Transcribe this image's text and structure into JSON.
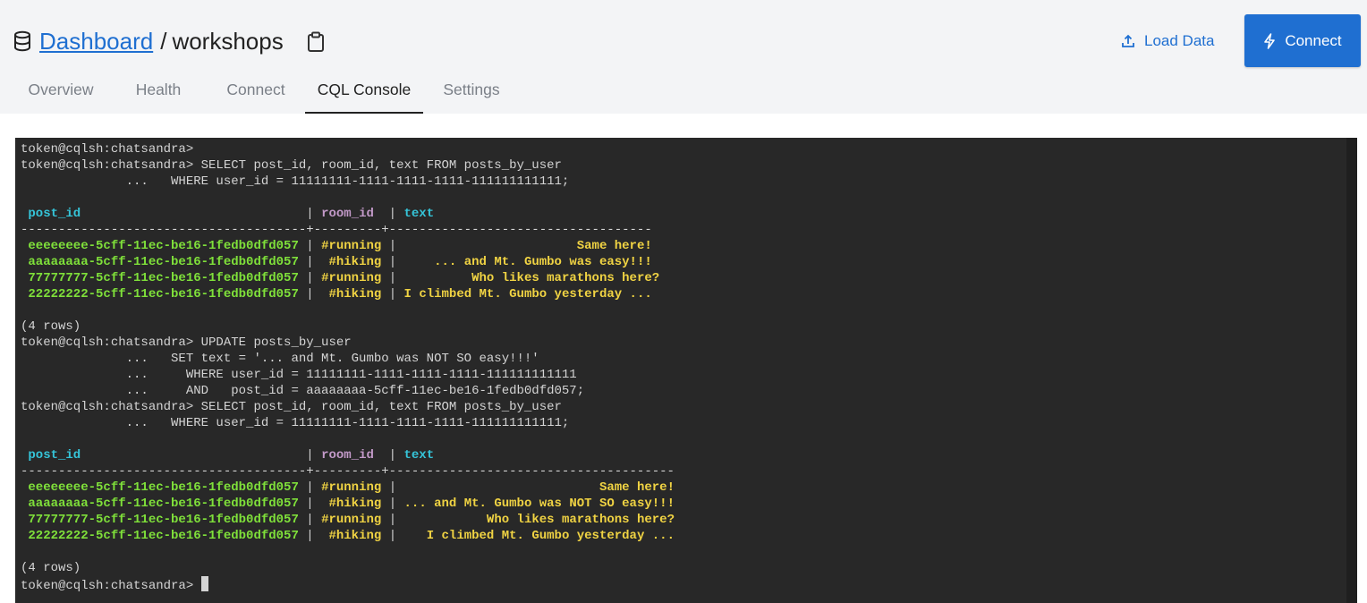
{
  "header": {
    "breadcrumb_link": "Dashboard",
    "separator": "/",
    "database": "workshops",
    "load_data_label": "Load Data",
    "connect_label": "Connect"
  },
  "tabs": [
    {
      "label": "Overview"
    },
    {
      "label": "Health"
    },
    {
      "label": "Connect"
    },
    {
      "label": "CQL Console",
      "active": true
    },
    {
      "label": "Settings"
    }
  ],
  "console": {
    "prompt": "token@cqlsh:chatsandra>",
    "lines": [
      {
        "type": "prompt",
        "text": "token@cqlsh:chatsandra>"
      },
      {
        "type": "plain",
        "text": "token@cqlsh:chatsandra> SELECT post_id, room_id, text FROM posts_by_user"
      },
      {
        "type": "plain",
        "text": "              ...   WHERE user_id = 11111111-1111-1111-1111-111111111111;"
      },
      {
        "type": "blank",
        "text": ""
      },
      {
        "type": "header",
        "post_id": " post_id",
        "room_id": "room_id",
        "text": "text",
        "pad1": "                              | ",
        "pad2": "  | "
      },
      {
        "type": "plain",
        "text": "--------------------------------------+---------+-----------------------------------"
      },
      {
        "type": "row",
        "post_id": " eeeeeeee-5cff-11ec-be16-1fedb0dfd057",
        "room_id": "#running",
        "text": "                       Same here!"
      },
      {
        "type": "row",
        "post_id": " aaaaaaaa-5cff-11ec-be16-1fedb0dfd057",
        "room_id": " #hiking",
        "text": "    ... and Mt. Gumbo was easy!!!"
      },
      {
        "type": "row",
        "post_id": " 77777777-5cff-11ec-be16-1fedb0dfd057",
        "room_id": "#running",
        "text": "         Who likes marathons here?"
      },
      {
        "type": "row",
        "post_id": " 22222222-5cff-11ec-be16-1fedb0dfd057",
        "room_id": " #hiking",
        "text": "I climbed Mt. Gumbo yesterday ..."
      },
      {
        "type": "blank",
        "text": ""
      },
      {
        "type": "plain",
        "text": "(4 rows)"
      },
      {
        "type": "plain",
        "text": "token@cqlsh:chatsandra> UPDATE posts_by_user"
      },
      {
        "type": "plain",
        "text": "              ...   SET text = '... and Mt. Gumbo was NOT SO easy!!!'"
      },
      {
        "type": "plain",
        "text": "              ...     WHERE user_id = 11111111-1111-1111-1111-111111111111"
      },
      {
        "type": "plain",
        "text": "              ...     AND   post_id = aaaaaaaa-5cff-11ec-be16-1fedb0dfd057;"
      },
      {
        "type": "plain",
        "text": "token@cqlsh:chatsandra> SELECT post_id, room_id, text FROM posts_by_user"
      },
      {
        "type": "plain",
        "text": "              ...   WHERE user_id = 11111111-1111-1111-1111-111111111111;"
      },
      {
        "type": "blank",
        "text": ""
      },
      {
        "type": "header",
        "post_id": " post_id",
        "room_id": "room_id",
        "text": "text",
        "pad1": "                              | ",
        "pad2": "  | "
      },
      {
        "type": "plain",
        "text": "--------------------------------------+---------+--------------------------------------"
      },
      {
        "type": "row",
        "post_id": " eeeeeeee-5cff-11ec-be16-1fedb0dfd057",
        "room_id": "#running",
        "text": "                          Same here!"
      },
      {
        "type": "row",
        "post_id": " aaaaaaaa-5cff-11ec-be16-1fedb0dfd057",
        "room_id": " #hiking",
        "text": "... and Mt. Gumbo was NOT SO easy!!!"
      },
      {
        "type": "row",
        "post_id": " 77777777-5cff-11ec-be16-1fedb0dfd057",
        "room_id": "#running",
        "text": "           Who likes marathons here?"
      },
      {
        "type": "row",
        "post_id": " 22222222-5cff-11ec-be16-1fedb0dfd057",
        "room_id": " #hiking",
        "text": "   I climbed Mt. Gumbo yesterday ..."
      },
      {
        "type": "blank",
        "text": ""
      },
      {
        "type": "plain",
        "text": "(4 rows)"
      },
      {
        "type": "cursor",
        "text": "token@cqlsh:chatsandra> "
      }
    ]
  },
  "colors": {
    "accent": "#1f6fd1",
    "terminal_bg": "#282828",
    "column_header": "#35c4d8",
    "room_header": "#c39ac9",
    "id_value": "#7fe03a",
    "text_value": "#f0d343"
  }
}
